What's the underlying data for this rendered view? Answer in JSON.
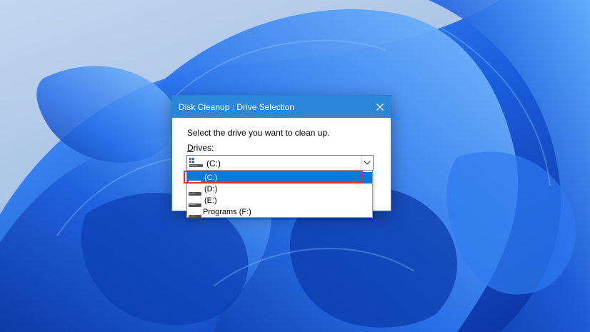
{
  "window": {
    "title": "Disk Cleanup : Drive Selection",
    "prompt": "Select the drive you want to clean up.",
    "drives_label_accel": "D",
    "drives_label_rest": "rives:"
  },
  "combo": {
    "selected_value": "(C:)"
  },
  "dropdown": {
    "items": [
      {
        "label": "(C:)",
        "icon": "system-drive-icon",
        "selected": true
      },
      {
        "label": "(D:)",
        "icon": "drive-icon",
        "selected": false
      },
      {
        "label": "(E:)",
        "icon": "drive-icon",
        "selected": false
      },
      {
        "label": "Programs (F:)",
        "icon": "drive-icon",
        "selected": false
      }
    ]
  },
  "annotation": {
    "highlight_color": "#e0313a",
    "highlighted_item": "(C:)"
  },
  "colors": {
    "titlebar": "#2c86d9",
    "selection": "#0a78d7",
    "wallpaper_primary": "#1f5fd6"
  }
}
